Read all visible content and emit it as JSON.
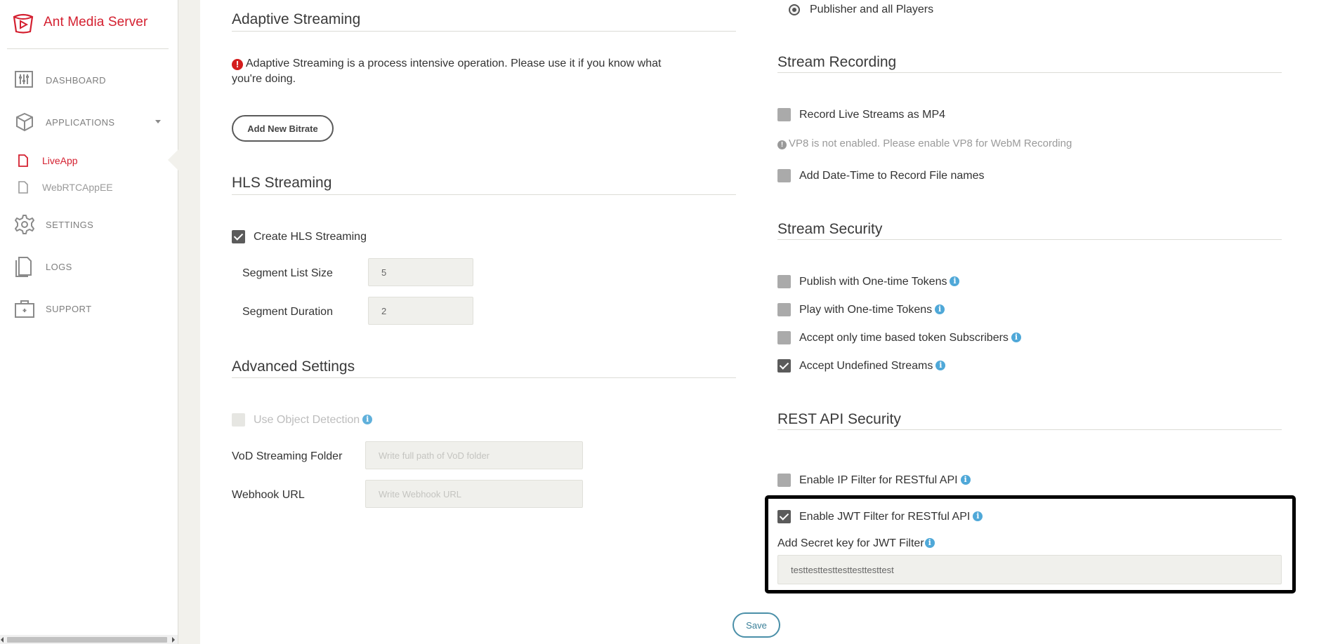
{
  "sidebar": {
    "brand": "Ant Media Server",
    "nav": {
      "dashboard": "DASHBOARD",
      "applications": "APPLICATIONS",
      "settings": "SETTINGS",
      "logs": "LOGS",
      "support": "SUPPORT"
    },
    "apps": [
      "LiveApp",
      "WebRTCAppEE"
    ],
    "active_app": "LiveApp"
  },
  "adaptive": {
    "title": "Adaptive Streaming",
    "warning_line1": "Adaptive Streaming is a process intensive operation. Please use it if you know what",
    "warning_line2": "you're doing.",
    "add_bitrate": "Add New Bitrate"
  },
  "hls": {
    "title": "HLS Streaming",
    "create_label": "Create HLS Streaming",
    "create_checked": true,
    "segment_list_label": "Segment List Size",
    "segment_list_value": "5",
    "segment_duration_label": "Segment Duration",
    "segment_duration_value": "2"
  },
  "advanced": {
    "title": "Advanced Settings",
    "object_detection_label": "Use Object Detection",
    "vod_label": "VoD Streaming Folder",
    "vod_placeholder": "Write full path of VoD folder",
    "webhook_label": "Webhook URL",
    "webhook_placeholder": "Write Webhook URL"
  },
  "players": {
    "radio_label": "Publisher and all Players"
  },
  "recording": {
    "title": "Stream Recording",
    "mp4_label": "Record Live Streams as MP4",
    "vp8_note": "VP8 is not enabled. Please enable VP8 for WebM Recording",
    "datetime_label": "Add Date-Time to Record File names"
  },
  "security": {
    "title": "Stream Security",
    "publish_tokens": "Publish with One-time Tokens",
    "play_tokens": "Play with One-time Tokens",
    "time_token": "Accept only time based token Subscribers",
    "undefined_streams": "Accept Undefined Streams"
  },
  "rest": {
    "title": "REST API Security",
    "ip_filter": "Enable IP Filter for RESTful API",
    "jwt_filter": "Enable JWT Filter for RESTful API",
    "secret_label": "Add Secret key for JWT Filter",
    "secret_value": "testtesttesttesttesttesttest"
  },
  "save_label": "Save",
  "colors": {
    "brand": "#d42030",
    "info": "#4fa8d8",
    "warning": "#d41c1c",
    "save": "#4a8fa8"
  }
}
